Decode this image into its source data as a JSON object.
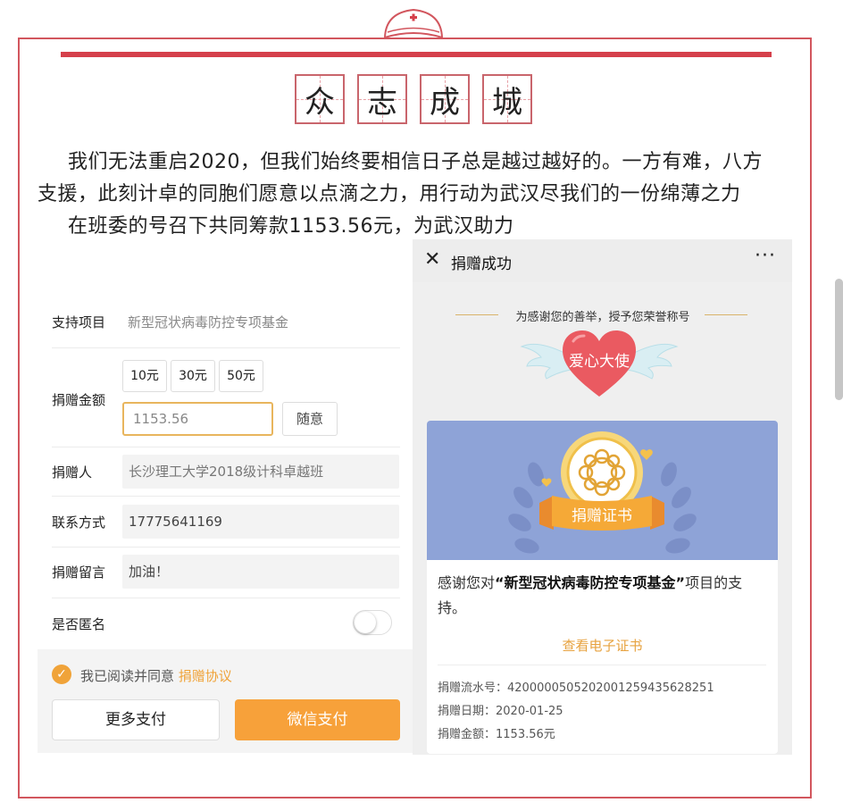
{
  "title_chars": [
    "众",
    "志",
    "成",
    "城"
  ],
  "paragraphs": {
    "p1_line1": "我们无法重启2020，但我们始终要相信日子总是越过越好的。一方有难，八方",
    "p1_line2": "支援，此刻计卓的同胞们愿意以点滴之力，用行动为武汉尽我们的一份绵薄之力",
    "p2": "在班委的号召下共同筹款1153.56元，为武汉助力"
  },
  "donation_form": {
    "project_label": "支持项目",
    "project_value": "新型冠状病毒防控专项基金",
    "amount_label": "捐赠金额",
    "amount_options": [
      "10元",
      "30元",
      "50元"
    ],
    "amount_input_value": "1153.56",
    "random_button": "随意",
    "donor_label": "捐赠人",
    "donor_value": "长沙理工大学2018级计科卓越班",
    "contact_label": "联系方式",
    "contact_value": "17775641169",
    "message_label": "捐赠留言",
    "message_value": "加油！",
    "anonymous_label": "是否匿名",
    "anonymous_enabled": false,
    "agree_text": "我已阅读并同意",
    "agree_link": "捐赠协议",
    "more_payment_button": "更多支付",
    "wechat_pay_button": "微信支付"
  },
  "success_panel": {
    "header_title": "捐赠成功",
    "close_icon": "close-icon",
    "more_icon": "more-icon",
    "honor_text": "为感谢您的善举，授予您荣誉称号",
    "badge_title": "爱心大使",
    "certificate_ribbon": "捐赠证书",
    "thanks_prefix": "感谢您对",
    "thanks_project": "“新型冠状病毒防控专项基金”",
    "thanks_suffix": "项目的支持。",
    "view_certificate": "查看电子证书",
    "serial_label": "捐赠流水号：",
    "serial_value": "4200000505202001259435628251",
    "date_label": "捐赠日期：",
    "date_value": "2020-01-25",
    "amount_label": "捐赠金额：",
    "amount_value": "1153.56元"
  },
  "colors": {
    "frame_red": "#d2565e",
    "accent_orange": "#f7a13a",
    "certificate_blue": "#8ea3d7",
    "heart_red": "#ea5a61"
  }
}
